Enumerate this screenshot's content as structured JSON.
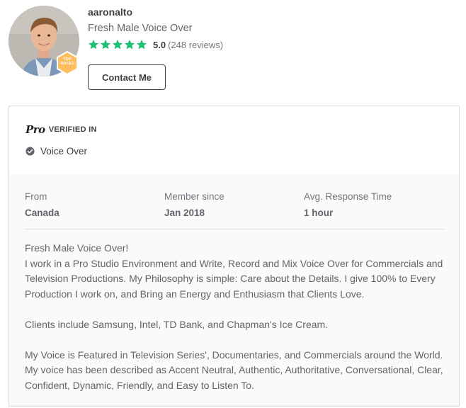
{
  "profile": {
    "username": "aaronalto",
    "tagline": "Fresh Male Voice Over",
    "rating_score": "5.0",
    "rating_count": "(248 reviews)",
    "stars": 5,
    "badge_line1": "TOP",
    "badge_line2": "RATED",
    "contact_label": "Contact Me"
  },
  "pro": {
    "logo": "Pro",
    "verified_label": "VERIFIED IN",
    "category": "Voice Over"
  },
  "stats": [
    {
      "label": "From",
      "value": "Canada"
    },
    {
      "label": "Member since",
      "value": "Jan 2018"
    },
    {
      "label": "Avg. Response Time",
      "value": "1 hour"
    }
  ],
  "description": {
    "p1_line1": "Fresh Male Voice Over!",
    "p1_line2": "I work in a Pro Studio Environment and Write, Record and Mix Voice Over for Commercials and Television Productions. My Philosophy is simple: Care about the Details. I give 100% to Every Production I work on, and Bring an Energy and Enthusiasm that Clients Love.",
    "p2": "Clients include Samsung, Intel, TD Bank, and Chapman's Ice Cream.",
    "p3": "My Voice is Featured in Television Series', Documentaries, and Commercials around the World. My voice has been described as Accent Neutral, Authentic, Authoritative, Conversational, Clear, Confident, Dynamic, Friendly, and Easy to Listen To."
  },
  "colors": {
    "star": "#1dbf73",
    "badge": "#ffbe5b",
    "text_dark": "#404145",
    "text_muted": "#74767e",
    "border": "#dadbdd"
  }
}
